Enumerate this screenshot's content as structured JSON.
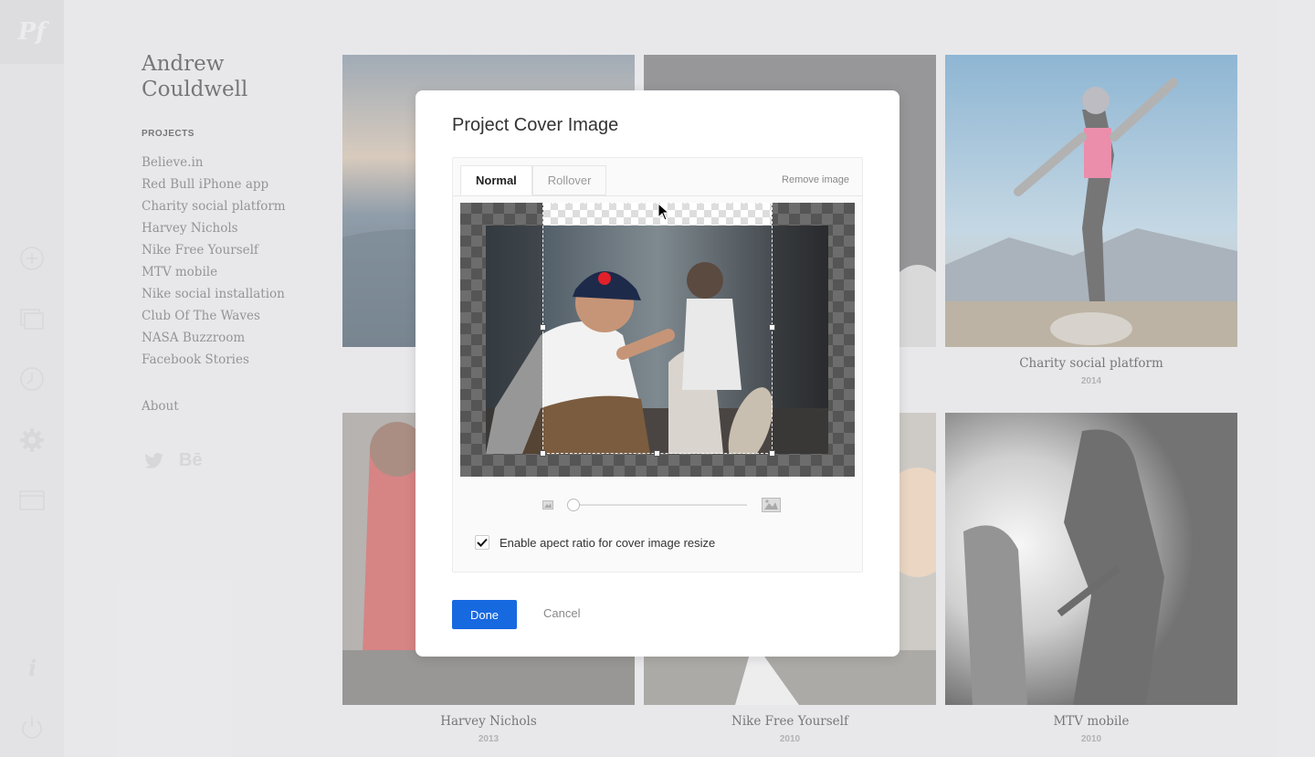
{
  "rail": {
    "logo": "Pf",
    "icons": [
      "add-icon",
      "layers-icon",
      "history-icon",
      "settings-icon",
      "browser-icon",
      "info-icon",
      "power-icon"
    ]
  },
  "site": {
    "author_first": "Andrew",
    "author_last": "Couldwell",
    "projects_heading": "PROJECTS",
    "projects": [
      "Believe.in",
      "Red Bull iPhone app",
      "Charity social platform",
      "Harvey Nichols",
      "Nike Free Yourself",
      "MTV mobile",
      "Nike social installation",
      "Club Of The Waves",
      "NASA Buzzroom",
      "Facebook Stories"
    ],
    "about": "About",
    "social": [
      "twitter-icon",
      "behance-icon"
    ],
    "behance_label": "Bē",
    "tiles": [
      {
        "title": "Charity social platform",
        "year": "2014"
      },
      {
        "title": "Harvey Nichols",
        "year": "2013"
      },
      {
        "title": "Nike Free Yourself",
        "year": "2010"
      },
      {
        "title": "MTV mobile",
        "year": "2010"
      }
    ]
  },
  "modal": {
    "title": "Project Cover Image",
    "tabs": [
      {
        "label": "Normal",
        "active": true
      },
      {
        "label": "Rollover",
        "active": false
      }
    ],
    "remove_label": "Remove image",
    "zoom_value": 0,
    "aspect_checkbox_checked": true,
    "aspect_label": "Enable apect ratio for cover image resize",
    "done_label": "Done",
    "cancel_label": "Cancel"
  },
  "colors": {
    "accent": "#1769e0",
    "background": "#e6e6e8"
  }
}
